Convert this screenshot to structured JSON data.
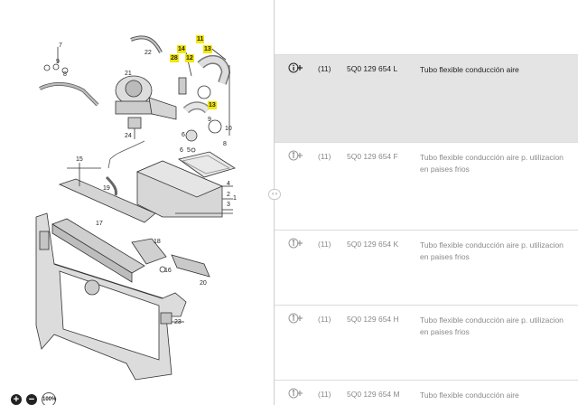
{
  "diagram": {
    "callouts": [
      {
        "id": "7",
        "text": "7",
        "highlight": false
      },
      {
        "id": "9a",
        "text": "9",
        "highlight": false
      },
      {
        "id": "8a",
        "text": "8",
        "highlight": false
      },
      {
        "id": "22",
        "text": "22",
        "highlight": false
      },
      {
        "id": "11",
        "text": "11",
        "highlight": true
      },
      {
        "id": "14",
        "text": "14",
        "highlight": true
      },
      {
        "id": "13a",
        "text": "13",
        "highlight": true
      },
      {
        "id": "28",
        "text": "28",
        "highlight": true
      },
      {
        "id": "12",
        "text": "12",
        "highlight": true
      },
      {
        "id": "21",
        "text": "21",
        "highlight": false
      },
      {
        "id": "13b",
        "text": "13",
        "highlight": true
      },
      {
        "id": "10",
        "text": "10",
        "highlight": false
      },
      {
        "id": "9b",
        "text": "9",
        "highlight": false
      },
      {
        "id": "6a",
        "text": "6",
        "highlight": false
      },
      {
        "id": "8b",
        "text": "8",
        "highlight": false
      },
      {
        "id": "24",
        "text": "24",
        "highlight": false
      },
      {
        "id": "6b",
        "text": "6",
        "highlight": false
      },
      {
        "id": "5",
        "text": "5",
        "highlight": false
      },
      {
        "id": "15",
        "text": "15",
        "highlight": false
      },
      {
        "id": "19",
        "text": "19",
        "highlight": false
      },
      {
        "id": "4",
        "text": "4",
        "highlight": false
      },
      {
        "id": "1",
        "text": "1",
        "highlight": false
      },
      {
        "id": "2",
        "text": "2",
        "highlight": false
      },
      {
        "id": "3",
        "text": "3",
        "highlight": false
      },
      {
        "id": "17",
        "text": "17",
        "highlight": false
      },
      {
        "id": "18",
        "text": "18",
        "highlight": false
      },
      {
        "id": "16",
        "text": "16",
        "highlight": false
      },
      {
        "id": "20",
        "text": "20",
        "highlight": false
      },
      {
        "id": "23",
        "text": "23",
        "highlight": false
      }
    ],
    "zoom": {
      "zoom_in": "+",
      "zoom_out": "−",
      "reset": "100%"
    },
    "divider_handle": "‹ ›"
  },
  "parts": [
    {
      "qty": "(11)",
      "part_number": "5Q0 129 654 L",
      "description": "Tubo flexible conducción aire",
      "selected": true
    },
    {
      "qty": "(11)",
      "part_number": "5Q0 129 654 F",
      "description": "Tubo flexible conducción aire p. utilizacion en paises frios",
      "selected": false
    },
    {
      "qty": "(11)",
      "part_number": "5Q0 129 654 K",
      "description": "Tubo flexible conducción aire p. utilizacion en paises frios",
      "selected": false
    },
    {
      "qty": "(11)",
      "part_number": "5Q0 129 654 H",
      "description": "Tubo flexible conducción aire p. utilizacion en paises frios",
      "selected": false
    },
    {
      "qty": "(11)",
      "part_number": "5Q0 129 654 M",
      "description": "Tubo flexible conducción aire",
      "selected": false
    }
  ],
  "colors": {
    "highlight": "#f3e600",
    "selected_row": "#e4e4e4",
    "muted_text": "#8a8a8a"
  }
}
